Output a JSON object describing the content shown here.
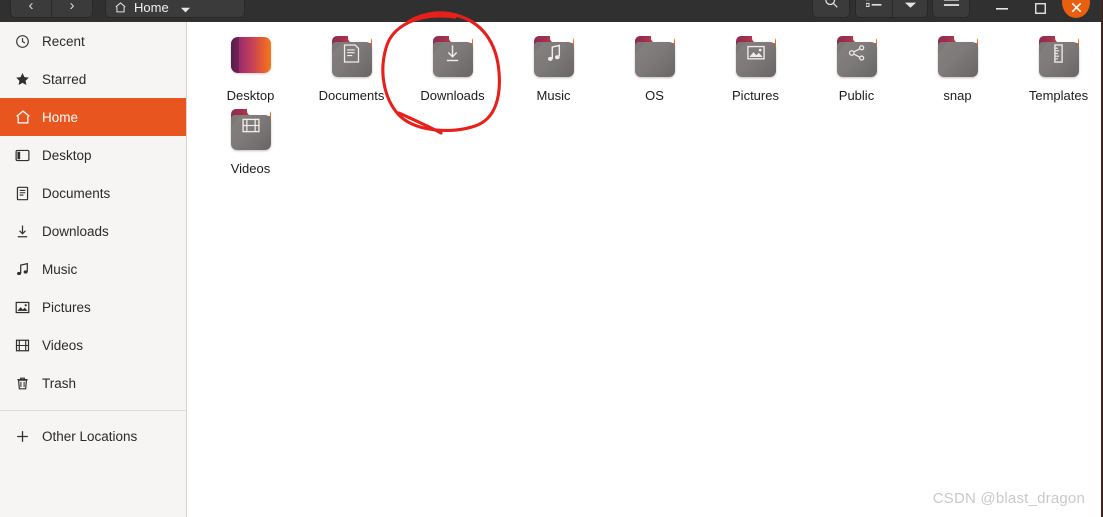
{
  "window": {
    "title": "Home",
    "nav": {
      "back_label": "‹",
      "forward_label": "›",
      "back_name": "back",
      "forward_name": "forward"
    },
    "path_button": {
      "label": "Home",
      "icon": "home-icon",
      "dropdown_icon": "chevron-down-icon"
    },
    "toolbar": [
      {
        "name": "search-icon",
        "label": "Search"
      },
      {
        "name": "list-view-icon",
        "label": "View as list"
      },
      {
        "name": "chevron-down-icon",
        "label": "View options"
      },
      {
        "name": "hamburger-menu-icon",
        "label": "Main menu"
      }
    ],
    "controls": [
      {
        "name": "minimize-button",
        "label": "–"
      },
      {
        "name": "maximize-button",
        "label": "□"
      },
      {
        "name": "close-button",
        "label": "✕",
        "color": "#e8600f"
      }
    ]
  },
  "sidebar": {
    "accent_color": "#e8551f",
    "background_color": "#f6f5f4",
    "items": [
      {
        "label": "Recent",
        "icon": "clock-icon",
        "active": false
      },
      {
        "label": "Starred",
        "icon": "star-icon",
        "active": false
      },
      {
        "label": "Home",
        "icon": "home-icon",
        "active": true
      },
      {
        "label": "Desktop",
        "icon": "desktop-icon",
        "active": false
      },
      {
        "label": "Documents",
        "icon": "document-icon",
        "active": false
      },
      {
        "label": "Downloads",
        "icon": "download-icon",
        "active": false
      },
      {
        "label": "Music",
        "icon": "music-icon",
        "active": false
      },
      {
        "label": "Pictures",
        "icon": "picture-icon",
        "active": false
      },
      {
        "label": "Videos",
        "icon": "video-icon",
        "active": false
      },
      {
        "label": "Trash",
        "icon": "trash-icon",
        "active": false
      }
    ],
    "other_locations": {
      "label": "Other Locations",
      "icon": "plus-icon"
    }
  },
  "files": [
    {
      "label": "Desktop",
      "kind": "desktop-special",
      "emblem": "none"
    },
    {
      "label": "Documents",
      "kind": "folder",
      "emblem": "document-icon"
    },
    {
      "label": "Downloads",
      "kind": "folder",
      "emblem": "download-icon",
      "annotated": true
    },
    {
      "label": "Music",
      "kind": "folder",
      "emblem": "music-icon"
    },
    {
      "label": "OS",
      "kind": "folder",
      "emblem": "none"
    },
    {
      "label": "Pictures",
      "kind": "folder",
      "emblem": "picture-icon"
    },
    {
      "label": "Public",
      "kind": "folder",
      "emblem": "share-icon"
    },
    {
      "label": "snap",
      "kind": "folder",
      "emblem": "none"
    },
    {
      "label": "Templates",
      "kind": "folder",
      "emblem": "ruler-icon"
    },
    {
      "label": "Videos",
      "kind": "folder",
      "emblem": "video-icon"
    }
  ],
  "annotation": {
    "shape": "hand-drawn-circle",
    "color": "#e8201c",
    "target": "Downloads"
  },
  "watermark": {
    "text": "CSDN @blast_dragon"
  }
}
